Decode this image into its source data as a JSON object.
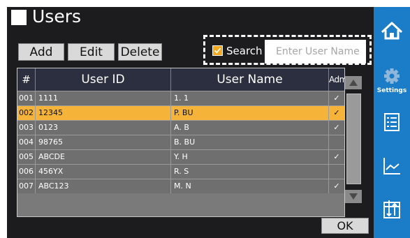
{
  "header": {
    "title": "Users"
  },
  "toolbar": {
    "add_label": "Add",
    "edit_label": "Edit",
    "delete_label": "Delete"
  },
  "search": {
    "label": "Search",
    "checked": true,
    "placeholder": "Enter User Name",
    "value": ""
  },
  "table": {
    "columns": [
      "#",
      "User ID",
      "User Name",
      "Admin"
    ],
    "rows": [
      {
        "num": "001",
        "user_id": "1111",
        "user_name": "1. 1",
        "admin": "✓"
      },
      {
        "num": "002",
        "user_id": "12345",
        "user_name": "P. BU",
        "admin": "✓"
      },
      {
        "num": "003",
        "user_id": "0123",
        "user_name": "A. B",
        "admin": "✓"
      },
      {
        "num": "004",
        "user_id": "98765",
        "user_name": "B. BU",
        "admin": ""
      },
      {
        "num": "005",
        "user_id": "ABCDE",
        "user_name": "Y. H",
        "admin": "✓"
      },
      {
        "num": "006",
        "user_id": "456YX",
        "user_name": "R. S",
        "admin": ""
      },
      {
        "num": "007",
        "user_id": "ABC123",
        "user_name": "M. N",
        "admin": "✓"
      }
    ],
    "selected_row": "002"
  },
  "footer": {
    "ok_label": "OK"
  },
  "sidebar": {
    "items": [
      {
        "name": "home-icon",
        "label": ""
      },
      {
        "name": "gear-icon",
        "label": "Settings"
      },
      {
        "name": "list-icon",
        "label": ""
      },
      {
        "name": "chart-icon",
        "label": ""
      },
      {
        "name": "transfer-icon",
        "label": ""
      }
    ]
  },
  "colors": {
    "accent": "#1b7cc8",
    "selected_row": "#f5b339",
    "header_bg": "#2c2f3f"
  }
}
